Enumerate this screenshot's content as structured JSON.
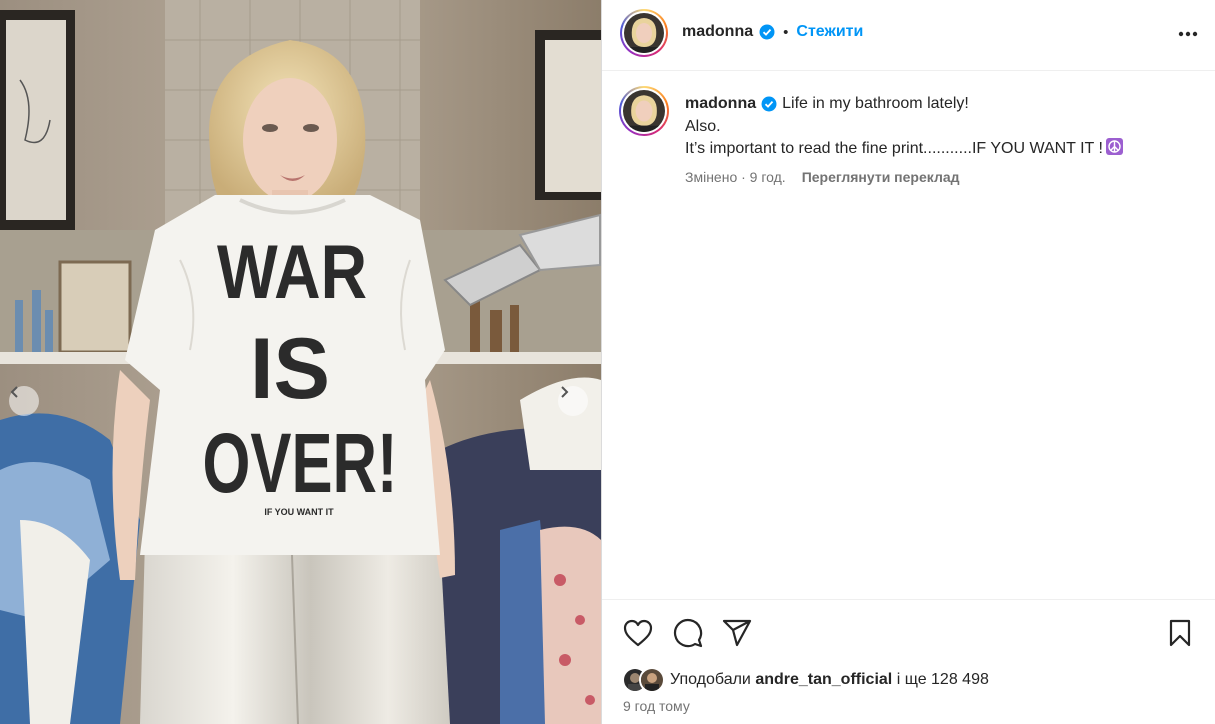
{
  "post": {
    "author": "madonna",
    "follow_label": "Стежити",
    "separator": "•",
    "caption": {
      "author": "madonna",
      "line1": "Life in my bathroom lately!",
      "line2": "Also.",
      "line3": "It’s important to read the fine print...........IF YOU WANT IT !"
    },
    "meta": {
      "edited": "Змінено · 9 год.",
      "translate": "Переглянути переклад"
    },
    "photo_text": {
      "shirt_line1": "WAR",
      "shirt_line2": "IS",
      "shirt_line3": "OVER!",
      "shirt_small": "IF YOU WANT IT"
    },
    "likes": {
      "prefix": "Уподобали",
      "user": "andre_tan_official",
      "suffix": "і ще 128 498"
    },
    "timestamp": "9 год тому"
  },
  "icons": [
    "verified-icon",
    "more-options-icon",
    "heart-icon",
    "comment-icon",
    "share-icon",
    "bookmark-icon",
    "chevron-left-icon",
    "chevron-right-icon",
    "peace-emoji-icon"
  ],
  "colors": {
    "accent": "#0095f6",
    "text": "#262626",
    "muted": "#737373",
    "divider": "#efefef",
    "peace_emoji": "#9c5fd0"
  }
}
